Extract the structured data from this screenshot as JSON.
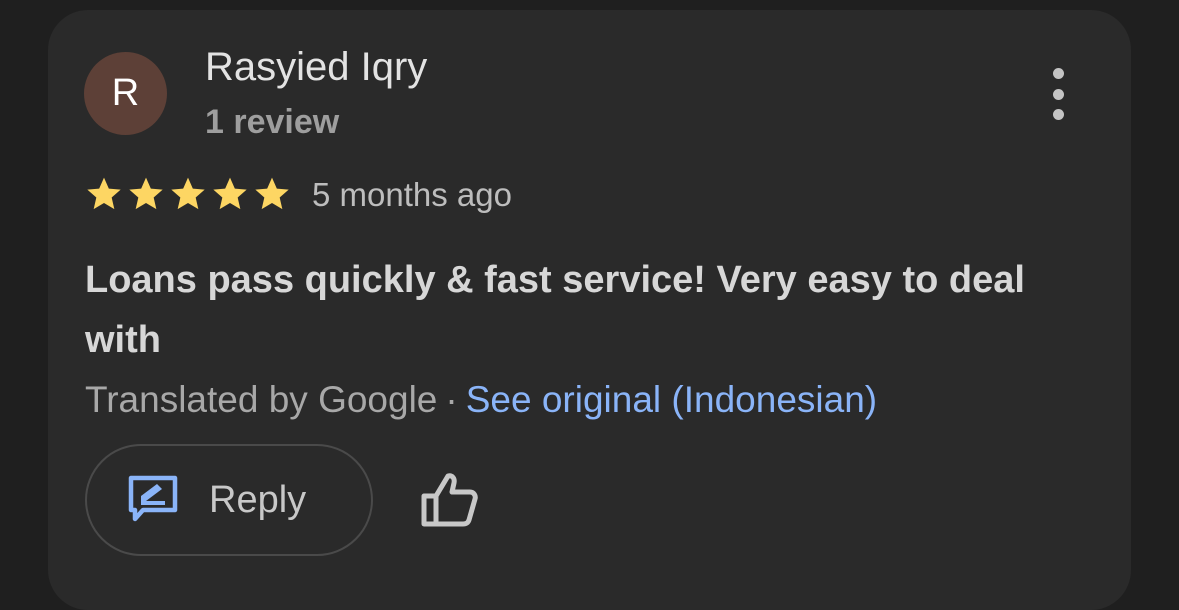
{
  "reviewer": {
    "initial": "R",
    "avatar_color": "#5d4037",
    "name": "Rasyied Iqry",
    "review_count": "1 review"
  },
  "rating": {
    "stars": 5,
    "max_stars": 5,
    "star_color": "#fdd663",
    "time_ago": "5 months ago"
  },
  "review": {
    "text": "Loans pass quickly & fast service! Very easy to deal with",
    "translated_by": "Translated by Google",
    "separator": "·",
    "see_original": "See original (Indonesian)"
  },
  "actions": {
    "reply_label": "Reply",
    "reply_icon": "reply-edit-icon",
    "like_icon": "thumbs-up-icon",
    "menu_icon": "more-vert-icon"
  },
  "colors": {
    "link": "#8ab4f8",
    "card_bg": "#2a2a2a",
    "page_bg": "#1f1f1f"
  }
}
